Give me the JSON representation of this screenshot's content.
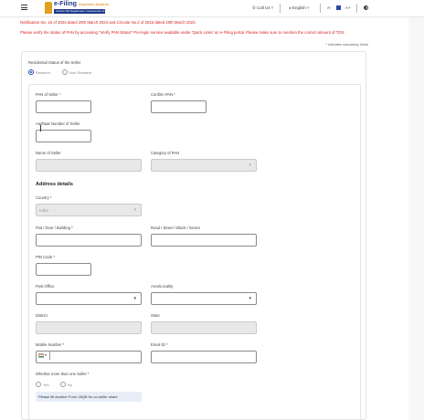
{
  "header": {
    "logo_title": "e-Filing",
    "logo_tagline": "Anywhere Anytime",
    "logo_subtitle": "Income Tax Department, Government of India",
    "call_us": "Call Us",
    "language": "English",
    "font_decrease": "A-",
    "font_increase": "A+"
  },
  "notices": {
    "line1": "Notification No. 15 of 2023 dated 20th March 2023 and Circular No.2 of 2023 dated 20th March 2023.",
    "line2": "Please verify the status of PAN by accessing \"Verify PAN Status\" Pre-login service available under 'Quick Links' on e-Filing portal. Please make sure to mention the correct amount of TDS."
  },
  "mandatory_note": "* Indicates mandatory fields",
  "residential": {
    "label": "Residential Status of the Seller",
    "options": [
      "Resident",
      "Non Resident"
    ],
    "selected": "Resident"
  },
  "fields": {
    "pan_label": "PAN of Seller *",
    "confirm_pan_label": "Confirm PAN *",
    "aadhaar_label": "Aadhaar Number of Seller",
    "name_label": "Name of Seller",
    "category_label": "Category of PAN"
  },
  "address": {
    "heading": "Address details",
    "country_label": "Country *",
    "country_value": "India",
    "flat_label": "Flat / Door / Building *",
    "road_label": "Road / Street / Block / Sector",
    "pin_label": "PIN Code *",
    "post_office_label": "Post Office",
    "area_label": "Area/Locality",
    "district_label": "District",
    "state_label": "State",
    "mobile_label": "Mobile Number *",
    "email_label": "Email ID *"
  },
  "multiple_sellers": {
    "label": "Whether more than one Seller *",
    "options": [
      "Yes",
      "No"
    ],
    "info": "Please fill another Form 26QB for co-seller share"
  },
  "colors": {
    "notice_red": "#d42020",
    "brand_blue": "#1e3a8a",
    "radio_accent": "#1e4aa8"
  }
}
